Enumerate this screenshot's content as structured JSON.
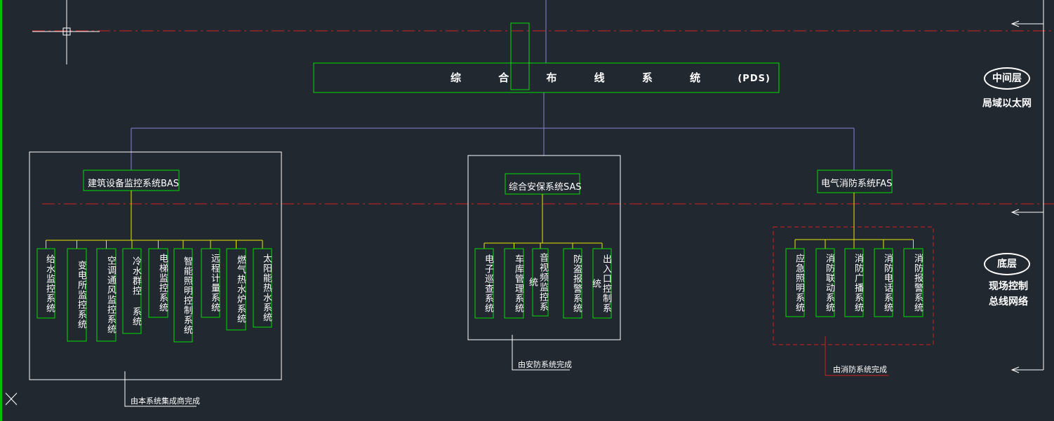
{
  "pds": {
    "title": "综 合 布 线 系 统",
    "suffix": "(PDS)"
  },
  "bas": {
    "label": "建筑设备监控系统BAS",
    "children": [
      "给水监控系统",
      "变电所监控系统",
      "空调通风监控系统",
      "冷水群控 系统",
      "电梯监控系统",
      "智能照明控制系统",
      "远程计量系统",
      "燃气热水炉系统",
      "太阳能热水系统"
    ],
    "note": "由本系统集成商完成"
  },
  "sas": {
    "label": "综合安保系统SAS",
    "children": [
      "电子巡查系统",
      "车库管理系统",
      "音视频监控系统",
      "防盗报警系统",
      "出入口控制系统"
    ],
    "note": "由安防系统完成"
  },
  "fas": {
    "label": "电气消防系统FAS",
    "children": [
      "应急照明系统",
      "消防联动系统",
      "消防广播系统",
      "消防电话系统",
      "消防报警系统"
    ],
    "note": "由消防系统完成"
  },
  "layers": {
    "middle": {
      "badge": "中间层",
      "desc": "局域以太网"
    },
    "bottom": {
      "badge": "底层",
      "desc_line1": "现场控制",
      "desc_line2": "总线网络"
    }
  },
  "colors": {
    "background": "#212830",
    "green": "#00e000",
    "yellow": "#e8e800",
    "purple": "#8a7fd8",
    "red_dashed": "#d02020",
    "white": "#ffffff"
  }
}
